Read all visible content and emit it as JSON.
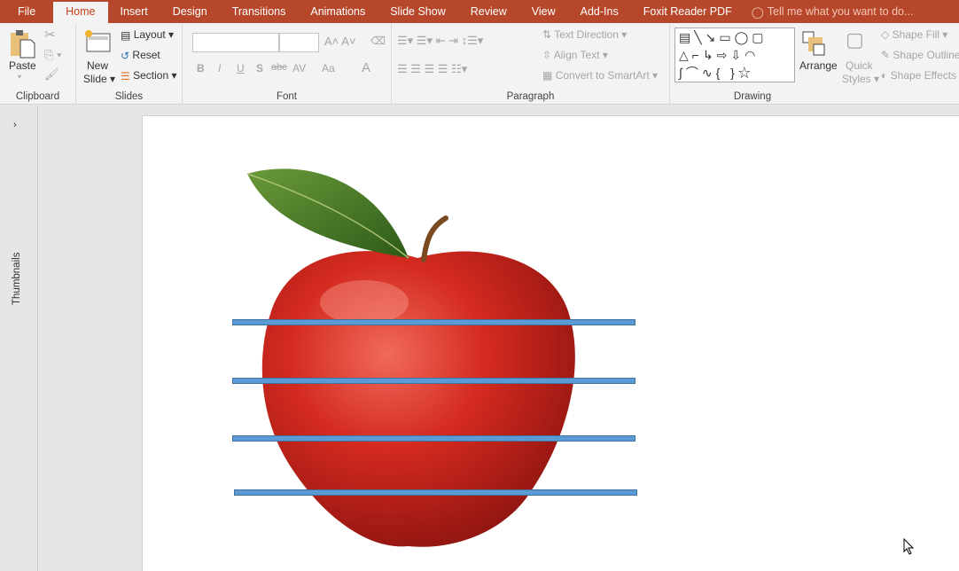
{
  "tabs": [
    "File",
    "Home",
    "Insert",
    "Design",
    "Transitions",
    "Animations",
    "Slide Show",
    "Review",
    "View",
    "Add-Ins",
    "Foxit Reader PDF"
  ],
  "tell_me": "Tell me what you want to do...",
  "clipboard": {
    "paste": "Paste",
    "label": "Clipboard"
  },
  "slides": {
    "new_slide_1": "New",
    "new_slide_2": "Slide",
    "layout": "Layout",
    "reset": "Reset",
    "section": "Section",
    "label": "Slides"
  },
  "font": {
    "label": "Font",
    "bold": "B",
    "italic": "I",
    "underline": "U",
    "shadow": "S",
    "strike": "abc",
    "spacing": "AV",
    "case": "Aa",
    "color": "A"
  },
  "paragraph": {
    "label": "Paragraph",
    "text_direction": "Text Direction",
    "align_text": "Align Text",
    "convert": "Convert to SmartArt"
  },
  "drawing": {
    "label": "Drawing",
    "arrange": "Arrange",
    "quick_1": "Quick",
    "quick_2": "Styles",
    "shape_fill": "Shape Fill",
    "shape_outline": "Shape Outline",
    "shape_effects": "Shape Effects"
  },
  "thumbnails": "Thumbnails",
  "colors": {
    "accent": "#b7472a",
    "line": "#5b9bd5"
  }
}
